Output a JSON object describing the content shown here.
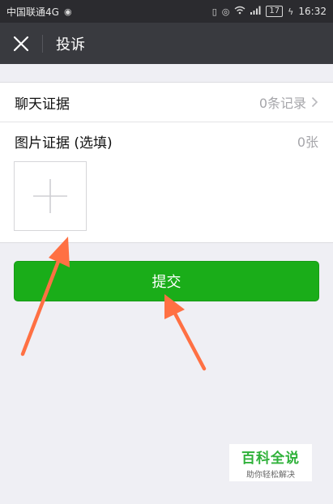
{
  "status_bar": {
    "carrier": "中国联通4G",
    "battery": "17",
    "time": "16:32",
    "icons": [
      "weibo-icon",
      "vibrate-icon",
      "eye-icon",
      "wifi-icon",
      "signal-icon",
      "battery-icon",
      "charging-icon"
    ]
  },
  "nav": {
    "title": "投诉",
    "close_icon": "close-icon"
  },
  "form": {
    "chat_evidence_label": "聊天证据",
    "chat_evidence_value": "0条记录",
    "image_evidence_label": "图片证据 (选填)",
    "image_evidence_value": "0张"
  },
  "submit_label": "提交",
  "watermark": {
    "title": "百科全说",
    "subtitle": "助你轻松解决"
  },
  "colors": {
    "status_bg": "#2b2b2f",
    "nav_bg": "#393a3f",
    "page_bg": "#efeff4",
    "submit_green": "#1aad19",
    "annotation_arrow": "#ff7043",
    "watermark_green": "#2fb13a"
  }
}
